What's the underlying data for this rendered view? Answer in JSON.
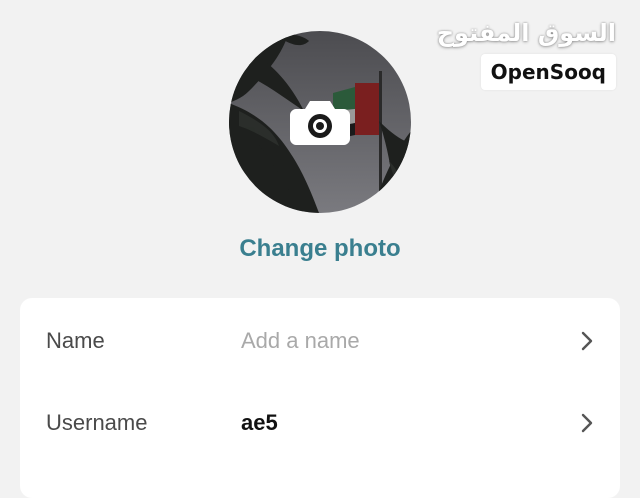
{
  "watermark": {
    "arabic_text": "السوق المفتوح",
    "brand_text": "OpenSooq"
  },
  "profile": {
    "change_photo_label": "Change photo",
    "camera_icon": "camera-icon"
  },
  "fields": [
    {
      "label": "Name",
      "value": "",
      "placeholder": "Add a name",
      "icon": "chevron-right-icon"
    },
    {
      "label": "Username",
      "value": "ae5",
      "placeholder": "",
      "icon": "chevron-right-icon"
    }
  ],
  "colors": {
    "accent": "#3a7f8f",
    "background": "#f2f2f2",
    "card": "#ffffff"
  }
}
